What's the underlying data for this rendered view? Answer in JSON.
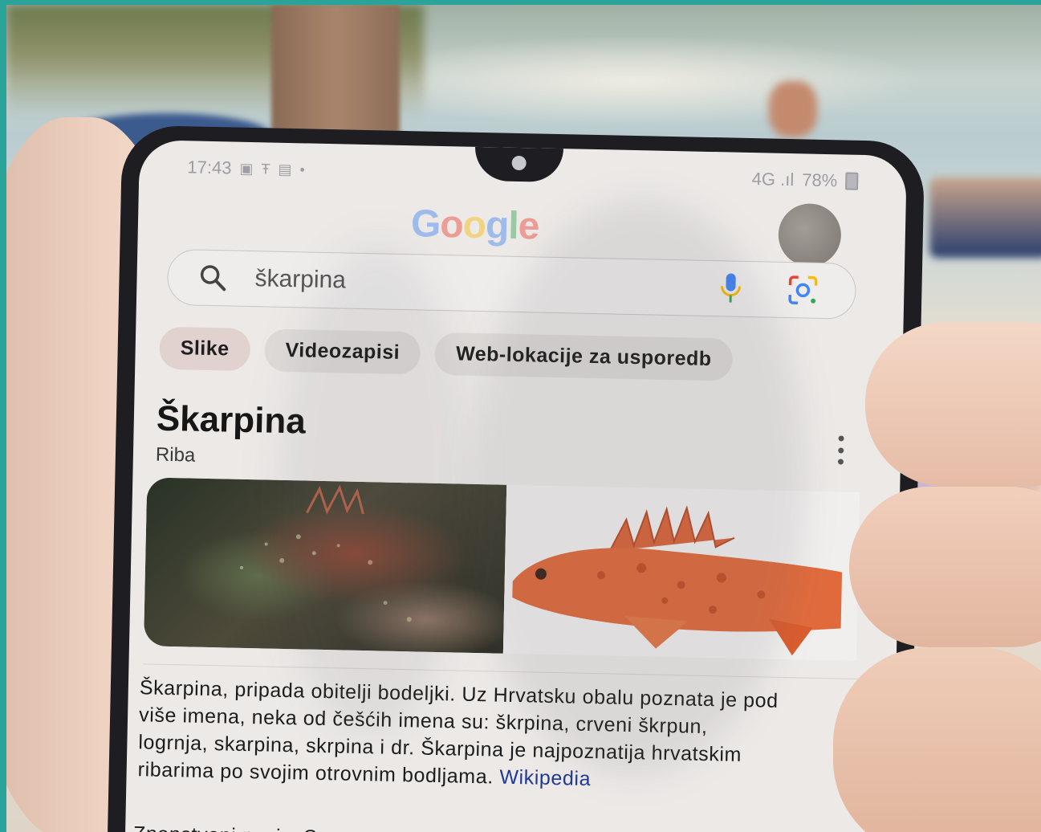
{
  "status_bar": {
    "time": "17:43",
    "signal": "4G .ıl",
    "battery": "78%"
  },
  "google": {
    "logo_letters": [
      "G",
      "o",
      "o",
      "g",
      "l",
      "e"
    ]
  },
  "search": {
    "query": "škarpina"
  },
  "chips": [
    {
      "label": "Slike"
    },
    {
      "label": "Videozapisi"
    },
    {
      "label": "Web-lokacije za usporedb"
    }
  ],
  "knowledge_panel": {
    "title": "Škarpina",
    "subtitle": "Riba",
    "description": "Škarpina, pripada obitelji bodeljki. Uz Hrvatsku obalu poznata je pod više imena, neka od češćih imena su: škrpina, crveni škrpun, logrnja, skarpina, skrpina i dr. Škarpina je najpoznatija hrvatskim ribarima po svojim otrovnim bodljama.",
    "source_link": "Wikipedia",
    "scientific_name_label": "Znanstveni naziv: Scorpaena"
  },
  "colors": {
    "google_blue": "#4285f4",
    "google_red": "#ea4335",
    "google_yellow": "#fbbc05",
    "google_green": "#34a853",
    "link": "#1f3a93"
  },
  "icons": {
    "search": "search-icon",
    "mic": "microphone-icon",
    "lens": "google-lens-icon",
    "more": "more-vert-icon"
  }
}
